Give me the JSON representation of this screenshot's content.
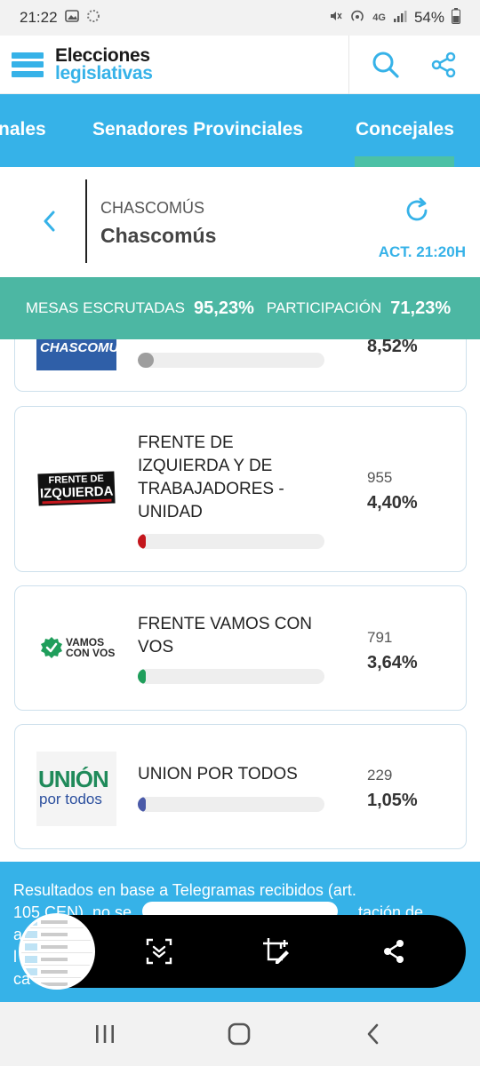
{
  "status": {
    "time": "21:22",
    "network": "4G",
    "battery": "54%",
    "icons": [
      "gallery-icon",
      "loading-icon",
      "mute-icon",
      "hotspot-icon",
      "signal-icon",
      "battery-icon"
    ]
  },
  "header": {
    "logo_line1": "Elecciones",
    "logo_line2": "legislativas",
    "icons": [
      "search-icon",
      "share-icon"
    ]
  },
  "tabs": [
    {
      "label": "nales"
    },
    {
      "label": "Senadores Provinciales"
    },
    {
      "label": "Concejales",
      "active": true
    }
  ],
  "location": {
    "region": "CHASCOMÚS",
    "name": "Chascomús",
    "updated": "ACT. 21:20H"
  },
  "stats": {
    "mesas_label": "MESAS ESCRUTADAS",
    "mesas_value": "95,23%",
    "part_label": "PARTICIPACIÓN",
    "part_value": "71,23%"
  },
  "parties": [
    {
      "logo_text": "CHASCOMUS",
      "name": "",
      "votes": "",
      "pct": "8,52%",
      "bar_fraction": 0.0852,
      "color": "#9e9e9e"
    },
    {
      "logo_text_1": "FRENTE DE",
      "logo_text_2": "IZQUIERDA",
      "name": "FRENTE DE IZQUIERDA Y DE TRABAJADORES - UNIDAD",
      "votes": "955",
      "pct": "4,40%",
      "bar_fraction": 0.044,
      "color": "#c4161c"
    },
    {
      "logo_text_1": "VAMOS",
      "logo_text_2": "CON VOS",
      "name": "FRENTE VAMOS CON VOS",
      "votes": "791",
      "pct": "3,64%",
      "bar_fraction": 0.0364,
      "color": "#1f9e5b"
    },
    {
      "logo_text_1": "UNIÓN",
      "logo_text_2": "por todos",
      "name": "UNION POR TODOS",
      "votes": "229",
      "pct": "1,05%",
      "bar_fraction": 0.0105,
      "color": "#4a5aa8"
    }
  ],
  "footer": {
    "line1": "Resultados en base a Telegramas recibidos (art.",
    "line2a": "105 CEN), no se",
    "line2b": "tación de",
    "line3": "a",
    "line4": "l",
    "line5": "ca"
  },
  "toolbar": {
    "icons": [
      "scroll-capture-icon",
      "crop-edit-icon",
      "share-icon"
    ]
  },
  "nav": {
    "icons": [
      "recents-icon",
      "home-icon",
      "back-icon"
    ]
  }
}
